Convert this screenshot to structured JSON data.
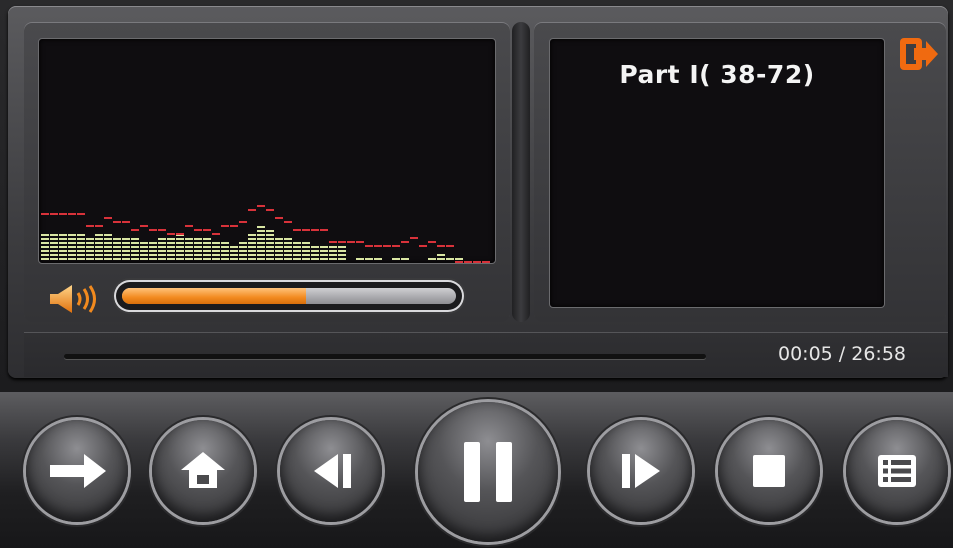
{
  "player": {
    "track_title": "Part I( 38-72)",
    "time_display": "00:05 / 26:58",
    "volume_level": 0.55,
    "seek_position": 0.003
  },
  "equalizer": {
    "bars": [
      7,
      7,
      7,
      7,
      7,
      6,
      7,
      7,
      6,
      6,
      6,
      5,
      5,
      6,
      6,
      7,
      6,
      6,
      6,
      5,
      5,
      4,
      5,
      7,
      9,
      8,
      6,
      6,
      5,
      5,
      4,
      4,
      4,
      4,
      0,
      1,
      1,
      1,
      0,
      1,
      1,
      0,
      0,
      1,
      2,
      1,
      1,
      0,
      0,
      0
    ],
    "peaks": [
      12,
      12,
      12,
      12,
      12,
      9,
      9,
      11,
      10,
      10,
      8,
      9,
      8,
      8,
      7,
      7,
      9,
      8,
      8,
      7,
      9,
      9,
      10,
      13,
      14,
      13,
      11,
      10,
      8,
      8,
      8,
      8,
      5,
      5,
      5,
      5,
      4,
      4,
      4,
      4,
      5,
      6,
      4,
      5,
      4,
      4,
      0,
      0,
      0,
      0
    ],
    "bar_color": "#d9e6a3",
    "peak_color": "#d8323a"
  },
  "colors": {
    "accent": "#f28a1e",
    "exit_icon": "#f06a10"
  },
  "icons": {
    "exit": "exit-icon",
    "volume": "speaker-icon",
    "next_arrow": "arrow-right-icon",
    "home": "home-icon",
    "previous": "previous-icon",
    "pause": "pause-icon",
    "next": "next-icon",
    "stop": "stop-icon",
    "playlist": "playlist-icon"
  }
}
